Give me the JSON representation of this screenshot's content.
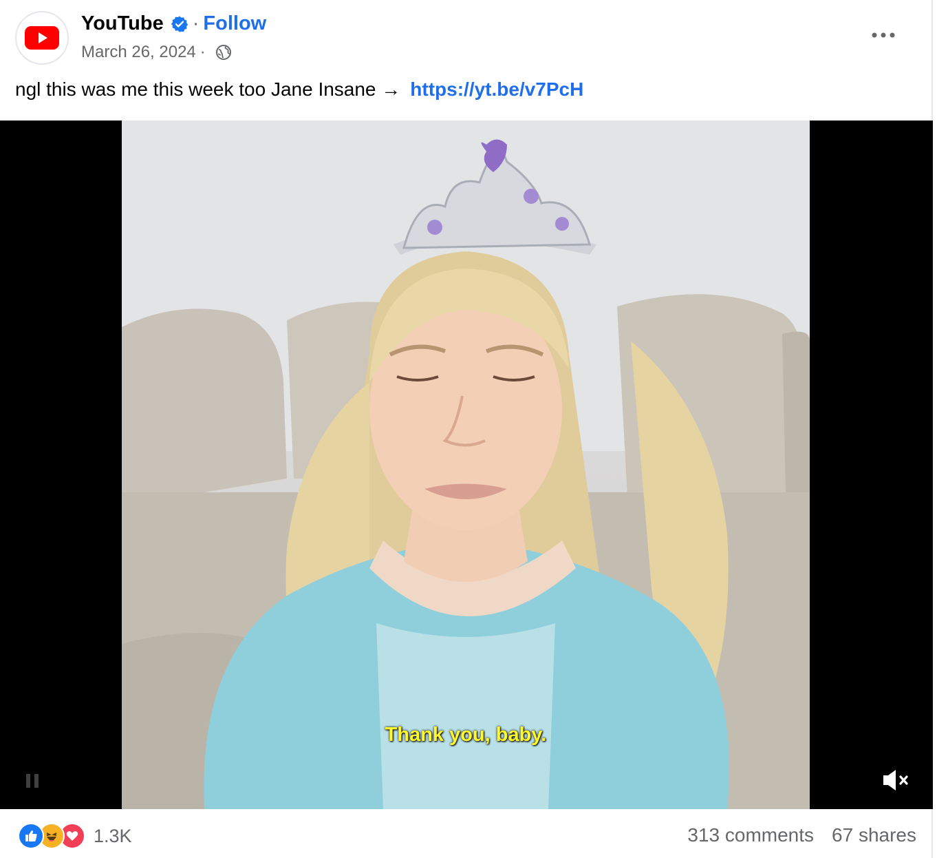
{
  "post": {
    "author": "YouTube",
    "separator": "·",
    "follow_label": "Follow",
    "date": "March 26, 2024",
    "date_separator": "·",
    "caption_text": "ngl this was me this week too Jane Insane →",
    "caption_link": "https://yt.be/v7PcH"
  },
  "video": {
    "subtitle": "Thank you, baby.",
    "muted": true
  },
  "footer": {
    "reaction_icons": [
      "like-icon",
      "haha-icon",
      "love-icon"
    ],
    "reaction_count": "1.3K",
    "comments": "313 comments",
    "shares": "67 shares"
  },
  "colors": {
    "brand_red": "#FF0000",
    "link_blue": "#1F6FEB",
    "secondary_text": "#65676B",
    "subtitle_yellow": "#FFF82A"
  }
}
